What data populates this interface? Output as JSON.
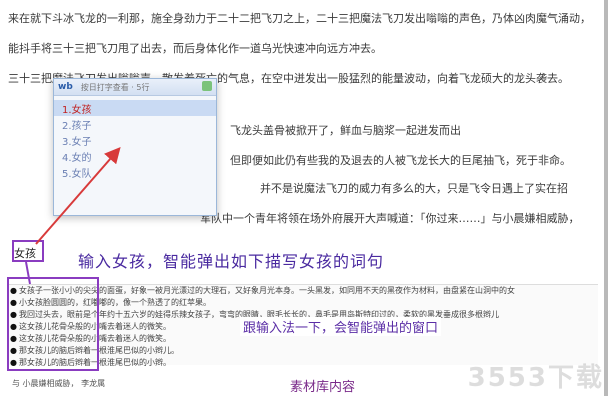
{
  "document_lines": [
    "来在就下斗冰飞龙的一利那，施全身劲力于二十二把飞刀之上，二十三把魔法飞刀发出嗡嗡的声色，乃体凶肉魔气涌动，",
    "能抖手将三十三把飞刀甩了出去，而后身体化作一道乌光快速冲向远方冲去。",
    "三十三把魔法飞刀发出嗡嗡声，散发着死亡的气息，在空中迸发出一股猛烈的能量波动，向着飞龙硕大的龙头袭去。",
    "飞龙头盖骨被掀开了，鲜血与脑浆一起迸发而出",
    "但即便如此仍有些我的及退去的人被飞龙长大的巨尾抽飞，死于非命。",
    "并不是说魔法飞刀的威力有多么的大，只是飞令日遇上了实在招",
    "军队中一个青年将领在场外府展开大声喊道：「你过来……」与小晨嫌相威胁，"
  ],
  "ime": {
    "logo": "wb",
    "status": "按日打字查看 · 5行",
    "input_text": "女孩",
    "candidates": [
      "1.女孩",
      "2.孩子",
      "3.女子",
      "4.女的",
      "5.女队"
    ]
  },
  "overlay_title": "输入女孩，智能弹出如下描写女孩的词句",
  "small_box_label": "女孩",
  "snippets": [
    "女孩子一张小小的尖尖的面蛋，好象一被月光漂过的大理石，又好象月光本身。一头黑发，如同用不天的黑夜作为材料，由盘紧在山洞中的女",
    "小女孩脸圆圆的，红嘟嘟的，像一个熟透了的红苹果。",
    "我回过头去，眼前是个年约十五六岁的娃得乐辣女孩子，弯弯的眼睛，眼毛长长的，鼻毛是用岛斯特印过的，柔软的黑发垂成很多根辫儿",
    "这女孩儿花骨朵般的小嘴去着迷人的微笑。",
    "这女孩儿花骨朵般的小嘴去着迷人的微笑。",
    "那女孩儿的脑后辫着一根淮尾巴似的小辫儿。",
    "那女孩儿的脑后辫着一根淮尾巴似的小辫。"
  ],
  "caption_mid": "跟输入法一下，会智能弹出的窗口",
  "caption_bottom": "素材库内容",
  "footer_line": "与  小晨嫌相威胁，  李龙属",
  "watermark": "3553下载",
  "accent_colors": {
    "annotation": "#8a3cc0",
    "arrow": "#d83a3a",
    "ime_selected": "#c02020"
  }
}
